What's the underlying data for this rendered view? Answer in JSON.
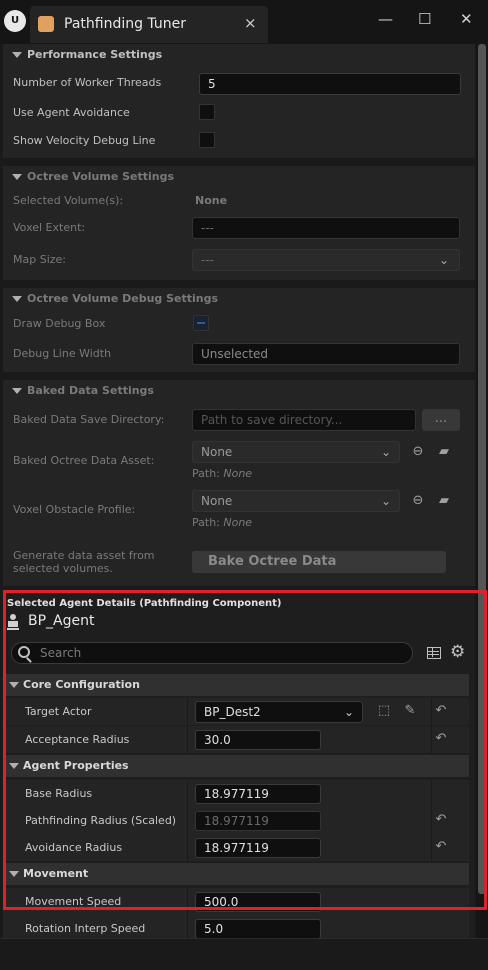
{
  "window": {
    "title": "Pathfinding Tuner",
    "close_tab": "×",
    "minimize": "—",
    "maximize": "☐",
    "close": "✕",
    "logo": "U"
  },
  "performance": {
    "title": "Performance Settings",
    "worker_threads_label": "Number of Worker Threads",
    "worker_threads_value": "5",
    "agent_avoidance_label": "Use Agent Avoidance",
    "velocity_debug_label": "Show Velocity Debug Line"
  },
  "octree_volume": {
    "title": "Octree Volume Settings",
    "selected_volumes_label": "Selected Volume(s):",
    "selected_volumes_value": "None",
    "voxel_extent_label": "Voxel Extent:",
    "voxel_extent_value": "---",
    "map_size_label": "Map Size:",
    "map_size_value": "---"
  },
  "octree_debug": {
    "title": "Octree Volume Debug Settings",
    "draw_debug_box_label": "Draw Debug Box",
    "debug_line_width_label": "Debug Line Width",
    "debug_line_width_value": "Unselected"
  },
  "baked": {
    "title": "Baked Data Settings",
    "save_dir_label": "Baked Data Save Directory:",
    "save_dir_placeholder": "Path to save directory...",
    "browse_label": "...",
    "octree_asset_label": "Baked Octree Data Asset:",
    "octree_asset_value": "None",
    "path_label": "Path:",
    "path_value": "None",
    "obstacle_profile_label": "Voxel Obstacle Profile:",
    "obstacle_profile_value": "None",
    "generate_label_line1": "Generate data asset from",
    "generate_label_line2": "selected volumes.",
    "bake_button": "Bake Octree Data"
  },
  "agent": {
    "header": "Selected Agent Details (Pathfinding Component)",
    "name": "BP_Agent",
    "search_placeholder": "Search",
    "core": {
      "title": "Core Configuration",
      "target_actor_label": "Target Actor",
      "target_actor_value": "BP_Dest2",
      "acceptance_radius_label": "Acceptance Radius",
      "acceptance_radius_value": "30.0"
    },
    "properties": {
      "title": "Agent Properties",
      "base_radius_label": "Base Radius",
      "base_radius_value": "18.977119",
      "pathfinding_radius_label": "Pathfinding Radius (Scaled)",
      "pathfinding_radius_value": "18.977119",
      "avoidance_radius_label": "Avoidance Radius",
      "avoidance_radius_value": "18.977119"
    },
    "movement": {
      "title": "Movement",
      "speed_label": "Movement Speed",
      "speed_value": "500.0",
      "rotation_label": "Rotation Interp Speed",
      "rotation_value": "5.0"
    }
  }
}
